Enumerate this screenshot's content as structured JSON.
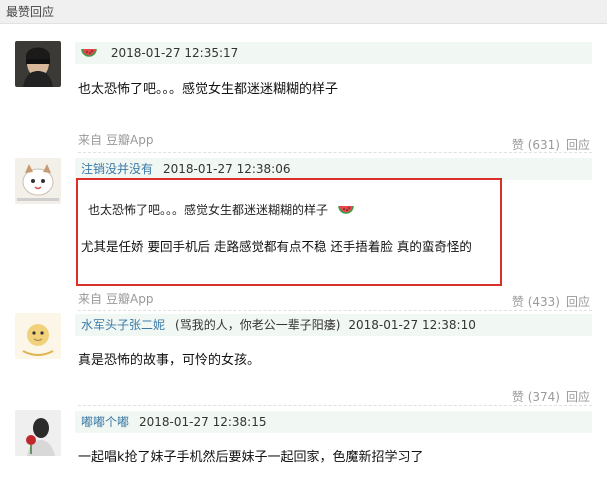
{
  "section": {
    "title": "最赞回应"
  },
  "comments": [
    {
      "author": "",
      "time": "2018-01-27 12:35:17",
      "text": "也太恐怖了吧。。。感觉女生都迷迷糊糊的样子",
      "source": {
        "prefix": "来自",
        "app": "豆瓣App"
      },
      "likes": "赞 (631)",
      "reply": "回应"
    },
    {
      "author": "注销没并没有",
      "time": "2018-01-27 12:38:06",
      "quote": "也太恐怖了吧。。。感觉女生都迷迷糊糊的样子",
      "text": "尤其是任娇 要回手机后 走路感觉都有点不稳 还手捂着脸 真的蛮奇怪的",
      "source": {
        "prefix": "来自",
        "app": "豆瓣App"
      },
      "likes": "赞 (433)",
      "reply": "回应"
    },
    {
      "author": "水军头子张二妮",
      "author_note": "(骂我的人，你老公一辈子阳痿)",
      "time": "2018-01-27 12:38:10",
      "text": "真是恐怖的故事，可怜的女孩。",
      "likes": "赞 (374)",
      "reply": "回应"
    },
    {
      "author": "嘟嘟个嘟",
      "time": "2018-01-27 12:38:15",
      "text": "一起唱k抢了妹子手机然后要妹子一起回家，色魔新招学习了"
    }
  ],
  "colors": {
    "meta_bg": "#f1f7f2",
    "author_link": "#3a7aa8",
    "highlight_border": "#d9302a",
    "muted": "#999999"
  },
  "icons": {
    "reaction": "watermelon-icon"
  }
}
